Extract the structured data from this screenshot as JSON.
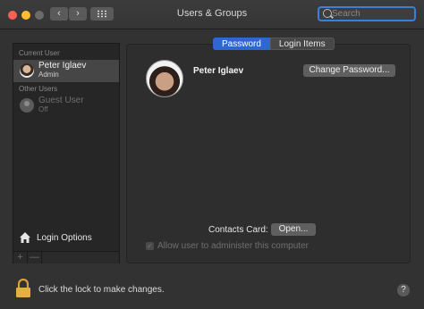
{
  "window": {
    "title": "Users & Groups"
  },
  "toolbar": {
    "back_glyph": "‹",
    "forward_glyph": "›",
    "search_placeholder": "Search"
  },
  "sidebar": {
    "current_user_header": "Current User",
    "current_user": {
      "name": "Peter Iglaev",
      "role": "Admin"
    },
    "other_users_header": "Other Users",
    "other_users": [
      {
        "name": "Guest User",
        "status": "Off"
      }
    ],
    "login_options_label": "Login Options",
    "add_glyph": "+",
    "remove_glyph": "—"
  },
  "tabs": [
    {
      "label": "Password",
      "active": true
    },
    {
      "label": "Login Items",
      "active": false
    }
  ],
  "user_panel": {
    "full_name": "Peter Iglaev",
    "change_password_label": "Change Password...",
    "contacts_card_label": "Contacts Card:",
    "open_button_label": "Open...",
    "allow_admin_label": "Allow user to administer this computer",
    "allow_admin_check_glyph": "✓"
  },
  "footer": {
    "lock_message": "Click the lock to make changes.",
    "help_glyph": "?"
  },
  "colors": {
    "accent": "#2f67d0",
    "background": "#323232",
    "close": "#ff5f57",
    "minimize": "#febc2e"
  },
  "icons": [
    "search-icon",
    "house-icon",
    "lock-icon",
    "help-icon",
    "grid-icon"
  ]
}
